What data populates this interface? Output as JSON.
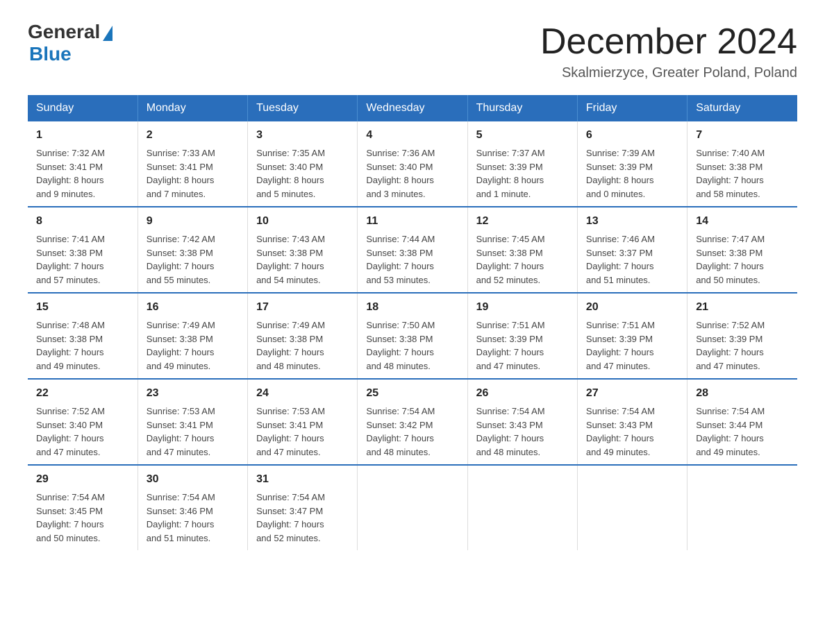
{
  "header": {
    "logo_general": "General",
    "logo_blue": "Blue",
    "month_title": "December 2024",
    "location": "Skalmierzyce, Greater Poland, Poland"
  },
  "weekdays": [
    "Sunday",
    "Monday",
    "Tuesday",
    "Wednesday",
    "Thursday",
    "Friday",
    "Saturday"
  ],
  "weeks": [
    [
      {
        "day": "1",
        "info": "Sunrise: 7:32 AM\nSunset: 3:41 PM\nDaylight: 8 hours\nand 9 minutes."
      },
      {
        "day": "2",
        "info": "Sunrise: 7:33 AM\nSunset: 3:41 PM\nDaylight: 8 hours\nand 7 minutes."
      },
      {
        "day": "3",
        "info": "Sunrise: 7:35 AM\nSunset: 3:40 PM\nDaylight: 8 hours\nand 5 minutes."
      },
      {
        "day": "4",
        "info": "Sunrise: 7:36 AM\nSunset: 3:40 PM\nDaylight: 8 hours\nand 3 minutes."
      },
      {
        "day": "5",
        "info": "Sunrise: 7:37 AM\nSunset: 3:39 PM\nDaylight: 8 hours\nand 1 minute."
      },
      {
        "day": "6",
        "info": "Sunrise: 7:39 AM\nSunset: 3:39 PM\nDaylight: 8 hours\nand 0 minutes."
      },
      {
        "day": "7",
        "info": "Sunrise: 7:40 AM\nSunset: 3:38 PM\nDaylight: 7 hours\nand 58 minutes."
      }
    ],
    [
      {
        "day": "8",
        "info": "Sunrise: 7:41 AM\nSunset: 3:38 PM\nDaylight: 7 hours\nand 57 minutes."
      },
      {
        "day": "9",
        "info": "Sunrise: 7:42 AM\nSunset: 3:38 PM\nDaylight: 7 hours\nand 55 minutes."
      },
      {
        "day": "10",
        "info": "Sunrise: 7:43 AM\nSunset: 3:38 PM\nDaylight: 7 hours\nand 54 minutes."
      },
      {
        "day": "11",
        "info": "Sunrise: 7:44 AM\nSunset: 3:38 PM\nDaylight: 7 hours\nand 53 minutes."
      },
      {
        "day": "12",
        "info": "Sunrise: 7:45 AM\nSunset: 3:38 PM\nDaylight: 7 hours\nand 52 minutes."
      },
      {
        "day": "13",
        "info": "Sunrise: 7:46 AM\nSunset: 3:37 PM\nDaylight: 7 hours\nand 51 minutes."
      },
      {
        "day": "14",
        "info": "Sunrise: 7:47 AM\nSunset: 3:38 PM\nDaylight: 7 hours\nand 50 minutes."
      }
    ],
    [
      {
        "day": "15",
        "info": "Sunrise: 7:48 AM\nSunset: 3:38 PM\nDaylight: 7 hours\nand 49 minutes."
      },
      {
        "day": "16",
        "info": "Sunrise: 7:49 AM\nSunset: 3:38 PM\nDaylight: 7 hours\nand 49 minutes."
      },
      {
        "day": "17",
        "info": "Sunrise: 7:49 AM\nSunset: 3:38 PM\nDaylight: 7 hours\nand 48 minutes."
      },
      {
        "day": "18",
        "info": "Sunrise: 7:50 AM\nSunset: 3:38 PM\nDaylight: 7 hours\nand 48 minutes."
      },
      {
        "day": "19",
        "info": "Sunrise: 7:51 AM\nSunset: 3:39 PM\nDaylight: 7 hours\nand 47 minutes."
      },
      {
        "day": "20",
        "info": "Sunrise: 7:51 AM\nSunset: 3:39 PM\nDaylight: 7 hours\nand 47 minutes."
      },
      {
        "day": "21",
        "info": "Sunrise: 7:52 AM\nSunset: 3:39 PM\nDaylight: 7 hours\nand 47 minutes."
      }
    ],
    [
      {
        "day": "22",
        "info": "Sunrise: 7:52 AM\nSunset: 3:40 PM\nDaylight: 7 hours\nand 47 minutes."
      },
      {
        "day": "23",
        "info": "Sunrise: 7:53 AM\nSunset: 3:41 PM\nDaylight: 7 hours\nand 47 minutes."
      },
      {
        "day": "24",
        "info": "Sunrise: 7:53 AM\nSunset: 3:41 PM\nDaylight: 7 hours\nand 47 minutes."
      },
      {
        "day": "25",
        "info": "Sunrise: 7:54 AM\nSunset: 3:42 PM\nDaylight: 7 hours\nand 48 minutes."
      },
      {
        "day": "26",
        "info": "Sunrise: 7:54 AM\nSunset: 3:43 PM\nDaylight: 7 hours\nand 48 minutes."
      },
      {
        "day": "27",
        "info": "Sunrise: 7:54 AM\nSunset: 3:43 PM\nDaylight: 7 hours\nand 49 minutes."
      },
      {
        "day": "28",
        "info": "Sunrise: 7:54 AM\nSunset: 3:44 PM\nDaylight: 7 hours\nand 49 minutes."
      }
    ],
    [
      {
        "day": "29",
        "info": "Sunrise: 7:54 AM\nSunset: 3:45 PM\nDaylight: 7 hours\nand 50 minutes."
      },
      {
        "day": "30",
        "info": "Sunrise: 7:54 AM\nSunset: 3:46 PM\nDaylight: 7 hours\nand 51 minutes."
      },
      {
        "day": "31",
        "info": "Sunrise: 7:54 AM\nSunset: 3:47 PM\nDaylight: 7 hours\nand 52 minutes."
      },
      {
        "day": "",
        "info": ""
      },
      {
        "day": "",
        "info": ""
      },
      {
        "day": "",
        "info": ""
      },
      {
        "day": "",
        "info": ""
      }
    ]
  ]
}
